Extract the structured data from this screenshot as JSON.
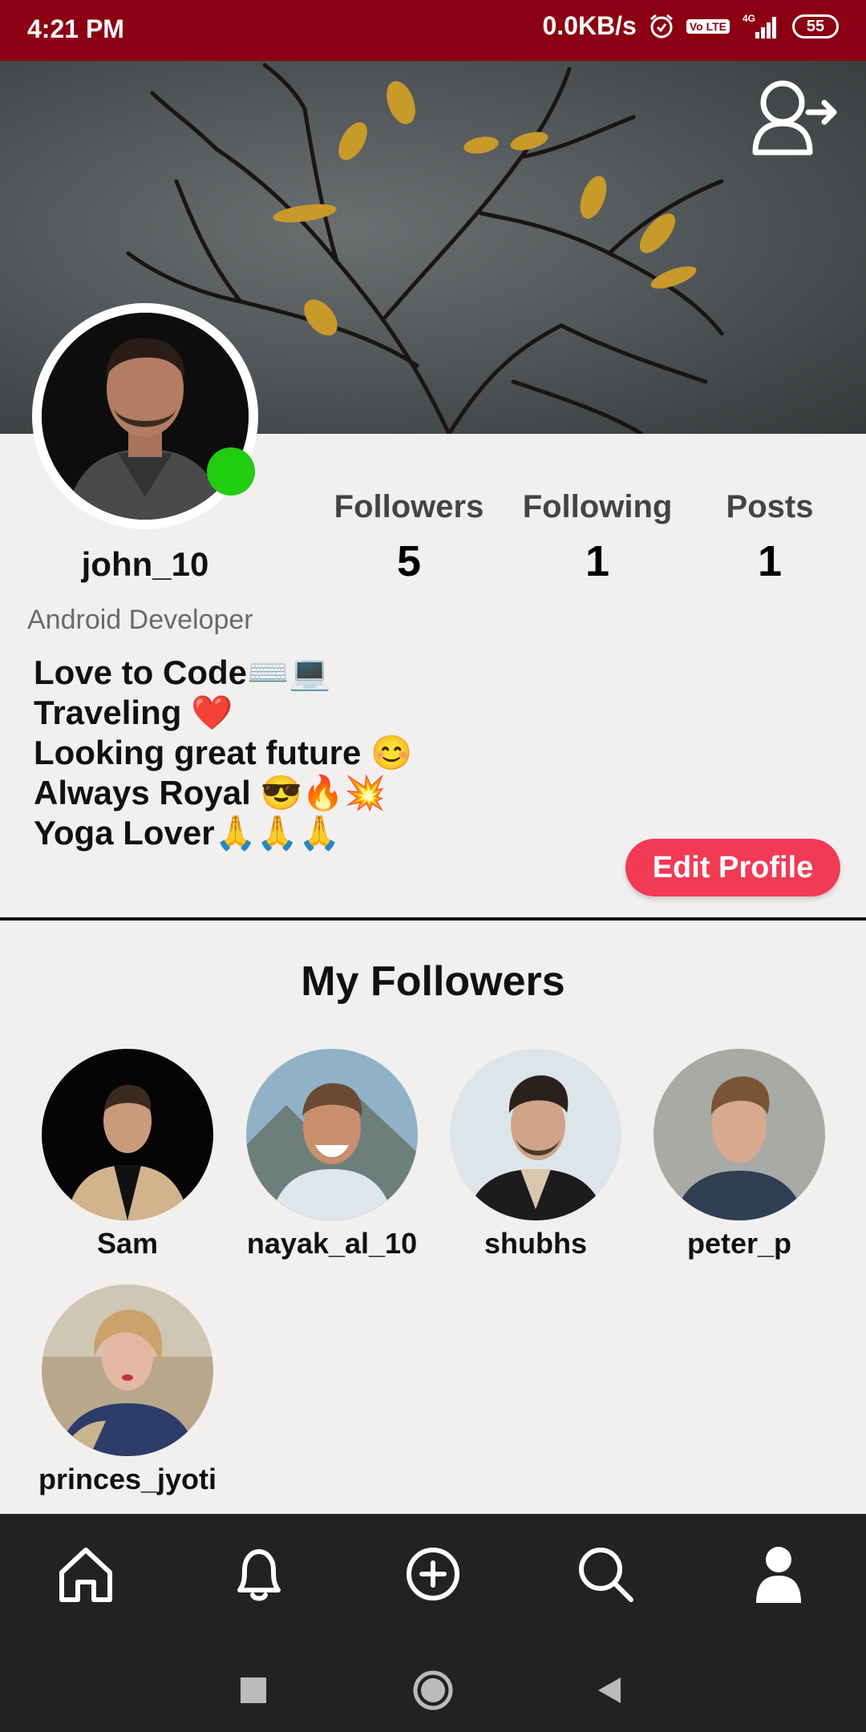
{
  "status_bar": {
    "time": "4:21 PM",
    "net_speed": "0.0KB/s",
    "volte_label": "Vo LTE",
    "network_type": "4G",
    "battery": "55"
  },
  "profile": {
    "username": "john_10",
    "job": "Android Developer",
    "online": true,
    "stats": {
      "followers_label": "Followers",
      "followers_count": "5",
      "following_label": "Following",
      "following_count": "1",
      "posts_label": "Posts",
      "posts_count": "1"
    },
    "bio": [
      "Love to Code⌨️💻",
      "Traveling ❤️",
      "Looking great future 😊",
      "Always Royal 😎🔥💥",
      "Yoga Lover🙏🙏🙏"
    ],
    "edit_button": "Edit Profile",
    "logout_icon": "user-logout-icon"
  },
  "followers_section": {
    "title": "My Followers",
    "followers": [
      {
        "name": "Sam"
      },
      {
        "name": "nayak_al_10"
      },
      {
        "name": "shubhs"
      },
      {
        "name": "peter_p"
      },
      {
        "name": "princes_jyoti"
      }
    ]
  },
  "bottom_nav": {
    "items": [
      "home-icon",
      "bell-icon",
      "add-circle-icon",
      "search-icon",
      "profile-icon"
    ],
    "active": "profile-icon"
  },
  "system_nav": [
    "recents-square-icon",
    "home-circle-icon",
    "back-triangle-icon"
  ],
  "colors": {
    "status_bar": "#8b0012",
    "accent": "#f23a55",
    "online": "#22cc11",
    "nav_bg": "#222222"
  }
}
